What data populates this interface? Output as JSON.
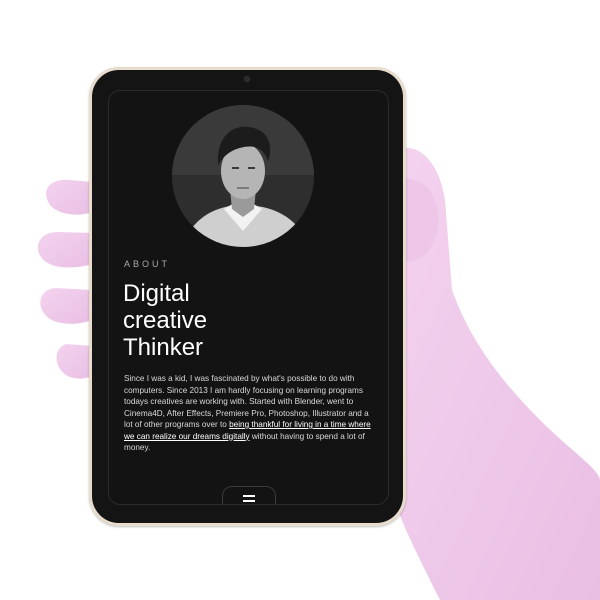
{
  "about": {
    "section_label": "ABOUT",
    "headline": [
      "Digital",
      "creative",
      "Thinker"
    ],
    "bio_intro": "Since I was a kid, I was fascinated by what's possible to do with computers. Since 2013 I am hardly focusing on learning programs todays creatives are working with. Started with Blender, went to Cinema4D, After Effects, Premiere Pro, Photoshop, Illustrator and a lot of other programs over to ",
    "bio_link": "being thankful for living in a time where we can realize our dreams digitally",
    "bio_outro": " without having to spend a lot of money."
  },
  "icons": {
    "menu": "hamburger-menu-icon",
    "avatar": "profile-portrait"
  },
  "colors": {
    "screen_bg": "#131313",
    "tablet_frame": "#e8dccd",
    "hand": "#f0c8ea",
    "text": "#ffffff",
    "muted": "#a8a8a8"
  }
}
